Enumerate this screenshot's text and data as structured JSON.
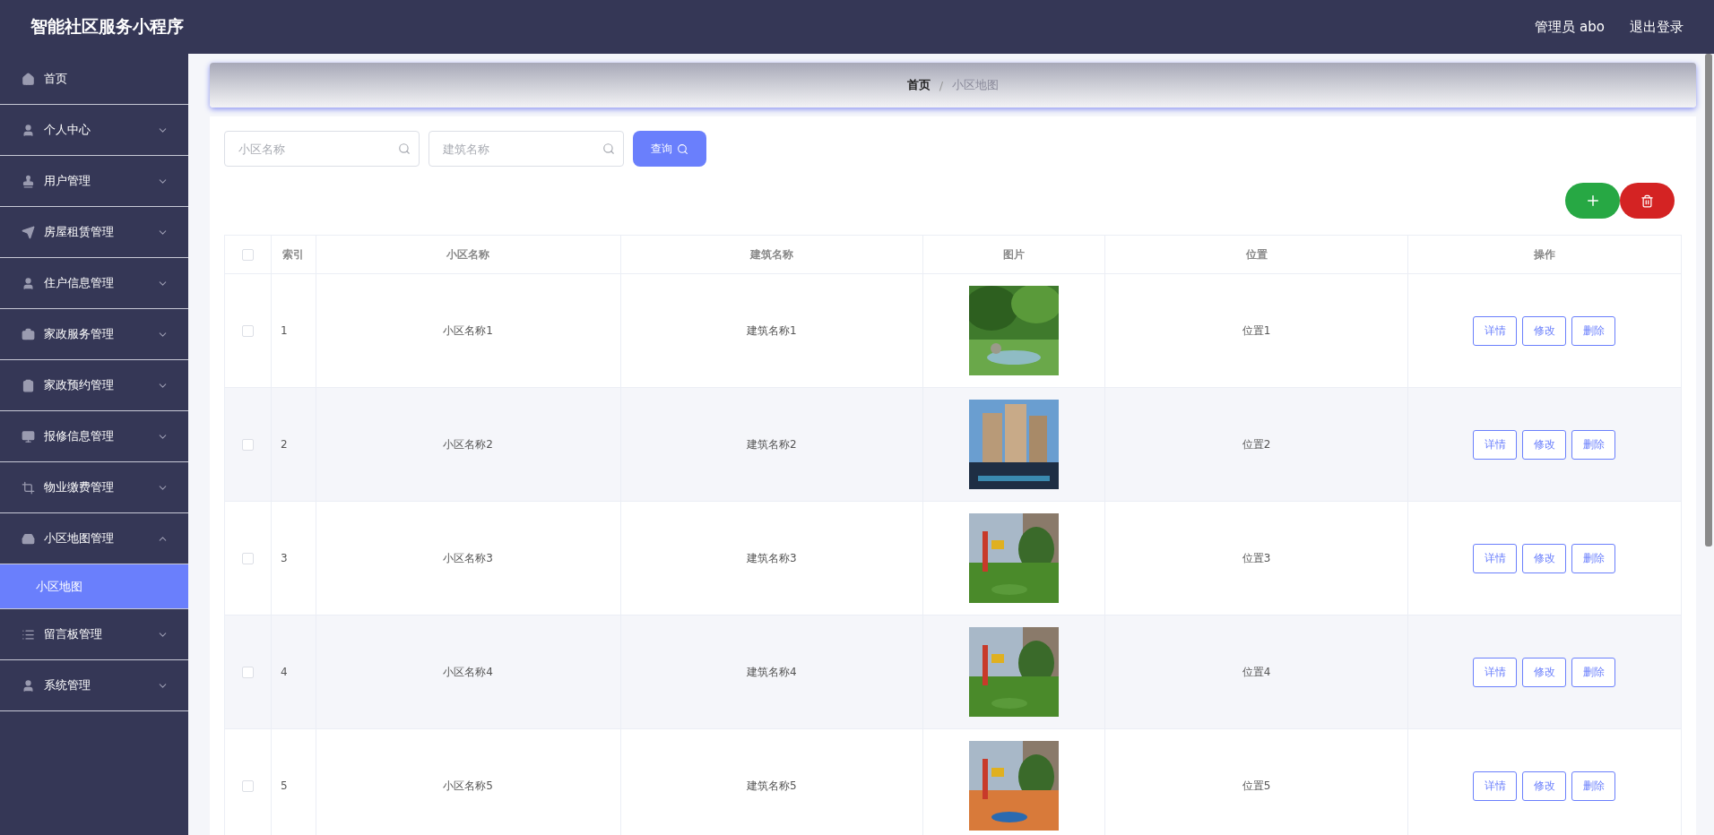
{
  "header": {
    "title": "智能社区服务小程序",
    "user": "管理员 abo",
    "logout": "退出登录"
  },
  "sidebar": {
    "items": [
      {
        "kind": "link",
        "label": "首页"
      },
      {
        "kind": "group",
        "label": "个人中心",
        "expanded": false
      },
      {
        "kind": "group",
        "label": "用户管理",
        "expanded": false
      },
      {
        "kind": "group",
        "label": "房屋租赁管理",
        "expanded": false
      },
      {
        "kind": "group",
        "label": "住户信息管理",
        "expanded": false
      },
      {
        "kind": "group",
        "label": "家政服务管理",
        "expanded": false
      },
      {
        "kind": "group",
        "label": "家政预约管理",
        "expanded": false
      },
      {
        "kind": "group",
        "label": "报修信息管理",
        "expanded": false
      },
      {
        "kind": "group",
        "label": "物业缴费管理",
        "expanded": false
      },
      {
        "kind": "group",
        "label": "小区地图管理",
        "expanded": true,
        "children": [
          {
            "label": "小区地图",
            "selected": true
          }
        ]
      },
      {
        "kind": "group",
        "label": "留言板管理",
        "expanded": false
      },
      {
        "kind": "group",
        "label": "系统管理",
        "expanded": false
      }
    ]
  },
  "breadcrumb": {
    "separator": "/",
    "items": [
      {
        "label": "首页",
        "current": false
      },
      {
        "label": "小区地图",
        "current": true
      }
    ]
  },
  "search": {
    "fields": [
      {
        "placeholder": "小区名称"
      },
      {
        "placeholder": "建筑名称"
      }
    ],
    "button": "查询"
  },
  "table": {
    "select_all_checked": false,
    "columns": [
      "索引",
      "小区名称",
      "建筑名称",
      "图片",
      "位置",
      "操作"
    ],
    "rows": [
      {
        "checked": false,
        "index": "1",
        "name": "小区名称1",
        "building": "建筑名称1",
        "position": "位置1",
        "actions": [
          "详情",
          "修改",
          "删除"
        ]
      },
      {
        "checked": false,
        "index": "2",
        "name": "小区名称2",
        "building": "建筑名称2",
        "position": "位置2",
        "actions": [
          "详情",
          "修改",
          "删除"
        ]
      },
      {
        "checked": false,
        "index": "3",
        "name": "小区名称3",
        "building": "建筑名称3",
        "position": "位置3",
        "actions": [
          "详情",
          "修改",
          "删除"
        ]
      },
      {
        "checked": false,
        "index": "4",
        "name": "小区名称4",
        "building": "建筑名称4",
        "position": "位置4",
        "actions": [
          "详情",
          "修改",
          "删除"
        ]
      },
      {
        "checked": false,
        "index": "5",
        "name": "小区名称5",
        "building": "建筑名称5",
        "position": "位置5",
        "actions": [
          "详情",
          "修改",
          "删除"
        ]
      }
    ]
  }
}
